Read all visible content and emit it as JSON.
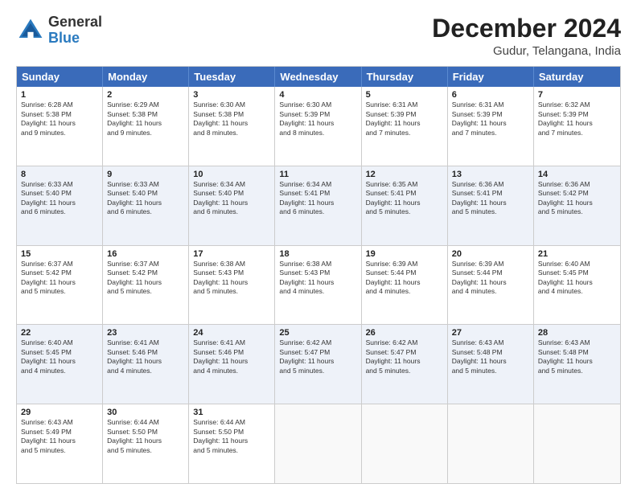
{
  "header": {
    "logo_general": "General",
    "logo_blue": "Blue",
    "month_title": "December 2024",
    "location": "Gudur, Telangana, India"
  },
  "weekdays": [
    "Sunday",
    "Monday",
    "Tuesday",
    "Wednesday",
    "Thursday",
    "Friday",
    "Saturday"
  ],
  "rows": [
    [
      {
        "day": "1",
        "info": "Sunrise: 6:28 AM\nSunset: 5:38 PM\nDaylight: 11 hours\nand 9 minutes."
      },
      {
        "day": "2",
        "info": "Sunrise: 6:29 AM\nSunset: 5:38 PM\nDaylight: 11 hours\nand 9 minutes."
      },
      {
        "day": "3",
        "info": "Sunrise: 6:30 AM\nSunset: 5:38 PM\nDaylight: 11 hours\nand 8 minutes."
      },
      {
        "day": "4",
        "info": "Sunrise: 6:30 AM\nSunset: 5:39 PM\nDaylight: 11 hours\nand 8 minutes."
      },
      {
        "day": "5",
        "info": "Sunrise: 6:31 AM\nSunset: 5:39 PM\nDaylight: 11 hours\nand 7 minutes."
      },
      {
        "day": "6",
        "info": "Sunrise: 6:31 AM\nSunset: 5:39 PM\nDaylight: 11 hours\nand 7 minutes."
      },
      {
        "day": "7",
        "info": "Sunrise: 6:32 AM\nSunset: 5:39 PM\nDaylight: 11 hours\nand 7 minutes."
      }
    ],
    [
      {
        "day": "8",
        "info": "Sunrise: 6:33 AM\nSunset: 5:40 PM\nDaylight: 11 hours\nand 6 minutes."
      },
      {
        "day": "9",
        "info": "Sunrise: 6:33 AM\nSunset: 5:40 PM\nDaylight: 11 hours\nand 6 minutes."
      },
      {
        "day": "10",
        "info": "Sunrise: 6:34 AM\nSunset: 5:40 PM\nDaylight: 11 hours\nand 6 minutes."
      },
      {
        "day": "11",
        "info": "Sunrise: 6:34 AM\nSunset: 5:41 PM\nDaylight: 11 hours\nand 6 minutes."
      },
      {
        "day": "12",
        "info": "Sunrise: 6:35 AM\nSunset: 5:41 PM\nDaylight: 11 hours\nand 5 minutes."
      },
      {
        "day": "13",
        "info": "Sunrise: 6:36 AM\nSunset: 5:41 PM\nDaylight: 11 hours\nand 5 minutes."
      },
      {
        "day": "14",
        "info": "Sunrise: 6:36 AM\nSunset: 5:42 PM\nDaylight: 11 hours\nand 5 minutes."
      }
    ],
    [
      {
        "day": "15",
        "info": "Sunrise: 6:37 AM\nSunset: 5:42 PM\nDaylight: 11 hours\nand 5 minutes."
      },
      {
        "day": "16",
        "info": "Sunrise: 6:37 AM\nSunset: 5:42 PM\nDaylight: 11 hours\nand 5 minutes."
      },
      {
        "day": "17",
        "info": "Sunrise: 6:38 AM\nSunset: 5:43 PM\nDaylight: 11 hours\nand 5 minutes."
      },
      {
        "day": "18",
        "info": "Sunrise: 6:38 AM\nSunset: 5:43 PM\nDaylight: 11 hours\nand 4 minutes."
      },
      {
        "day": "19",
        "info": "Sunrise: 6:39 AM\nSunset: 5:44 PM\nDaylight: 11 hours\nand 4 minutes."
      },
      {
        "day": "20",
        "info": "Sunrise: 6:39 AM\nSunset: 5:44 PM\nDaylight: 11 hours\nand 4 minutes."
      },
      {
        "day": "21",
        "info": "Sunrise: 6:40 AM\nSunset: 5:45 PM\nDaylight: 11 hours\nand 4 minutes."
      }
    ],
    [
      {
        "day": "22",
        "info": "Sunrise: 6:40 AM\nSunset: 5:45 PM\nDaylight: 11 hours\nand 4 minutes."
      },
      {
        "day": "23",
        "info": "Sunrise: 6:41 AM\nSunset: 5:46 PM\nDaylight: 11 hours\nand 4 minutes."
      },
      {
        "day": "24",
        "info": "Sunrise: 6:41 AM\nSunset: 5:46 PM\nDaylight: 11 hours\nand 4 minutes."
      },
      {
        "day": "25",
        "info": "Sunrise: 6:42 AM\nSunset: 5:47 PM\nDaylight: 11 hours\nand 5 minutes."
      },
      {
        "day": "26",
        "info": "Sunrise: 6:42 AM\nSunset: 5:47 PM\nDaylight: 11 hours\nand 5 minutes."
      },
      {
        "day": "27",
        "info": "Sunrise: 6:43 AM\nSunset: 5:48 PM\nDaylight: 11 hours\nand 5 minutes."
      },
      {
        "day": "28",
        "info": "Sunrise: 6:43 AM\nSunset: 5:48 PM\nDaylight: 11 hours\nand 5 minutes."
      }
    ],
    [
      {
        "day": "29",
        "info": "Sunrise: 6:43 AM\nSunset: 5:49 PM\nDaylight: 11 hours\nand 5 minutes."
      },
      {
        "day": "30",
        "info": "Sunrise: 6:44 AM\nSunset: 5:50 PM\nDaylight: 11 hours\nand 5 minutes."
      },
      {
        "day": "31",
        "info": "Sunrise: 6:44 AM\nSunset: 5:50 PM\nDaylight: 11 hours\nand 5 minutes."
      },
      {
        "day": "",
        "info": ""
      },
      {
        "day": "",
        "info": ""
      },
      {
        "day": "",
        "info": ""
      },
      {
        "day": "",
        "info": ""
      }
    ]
  ],
  "alt_rows": [
    1,
    3
  ]
}
